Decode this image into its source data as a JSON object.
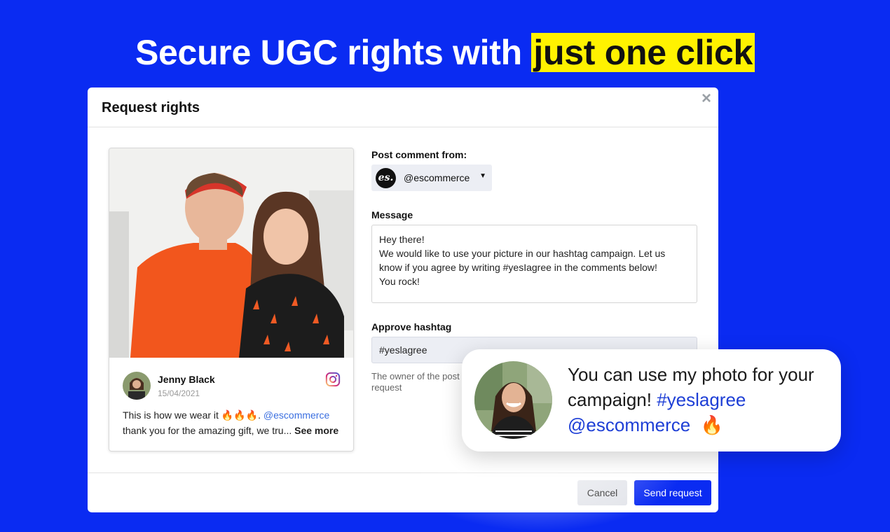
{
  "headline": {
    "prefix": "Secure UGC rights with ",
    "highlight": "just one click"
  },
  "modal": {
    "title": "Request rights",
    "close_icon": "close-icon",
    "post": {
      "author": "Jenny Black",
      "date": "15/04/2021",
      "platform_icon": "instagram-icon",
      "caption_start": "This is how we wear it 🔥🔥🔥. ",
      "caption_mention": "@escommerce",
      "caption_rest": " thank you for the amazing gift, we tru...",
      "see_more": "See more"
    },
    "post_comment_label": "Post comment from:",
    "account": {
      "logo_text": "es.",
      "name": "@escommerce"
    },
    "message_label": "Message",
    "message": "Hey there!\nWe would like to use your picture in our hashtag campaign. Let us know if you agree by writing #yesIagree in the comments below!\nYou rock!",
    "approve_label": "Approve hashtag",
    "hashtag_value": "#yeslagree",
    "hint": "The owner of the post request",
    "cancel_label": "Cancel",
    "send_label": "Send request"
  },
  "bubble": {
    "text_start": "You can use my photo for your campaign! ",
    "hashtag": "#yeslagree",
    "mention": "@escommerce",
    "emoji": "🔥"
  },
  "colors": {
    "brand_blue": "#0a2bf2",
    "highlight": "#fff200",
    "link": "#3b6fe0"
  }
}
